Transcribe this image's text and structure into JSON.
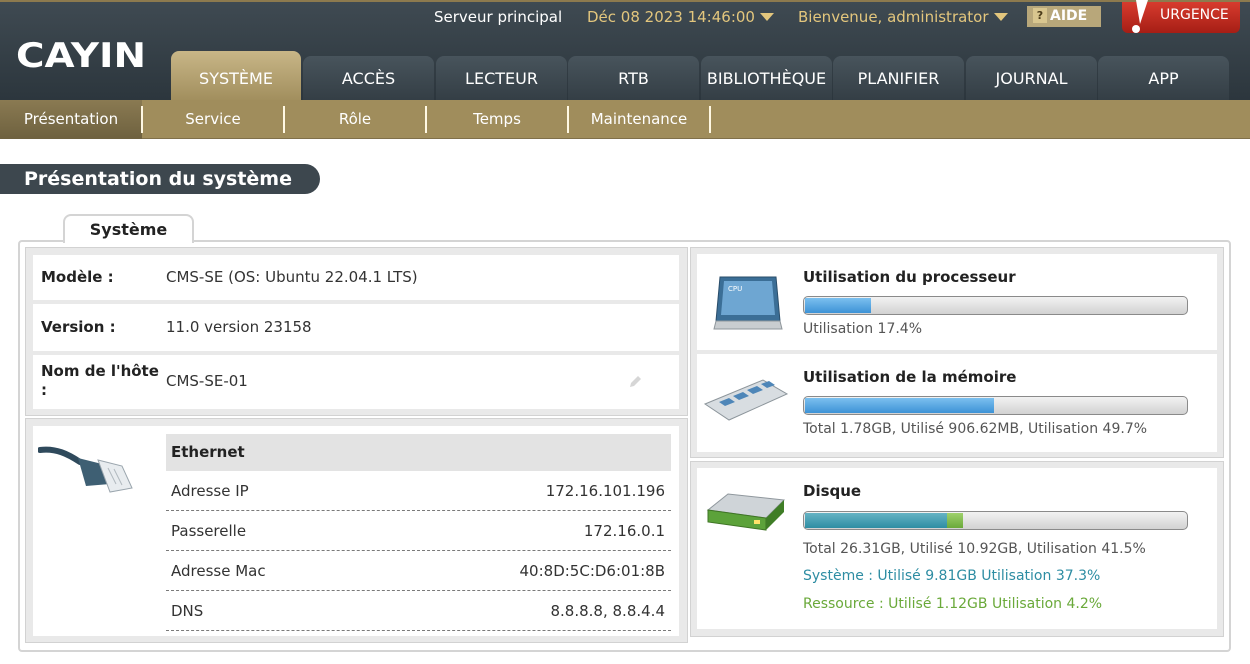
{
  "header": {
    "logo_text": "CAYIN",
    "server": "Serveur principal",
    "datetime": "Déc 08 2023 14:46:00",
    "user": "Bienvenue, administrator",
    "help": "AIDE",
    "help_icon": "?",
    "urgent": "URGENCE"
  },
  "main_tabs": [
    {
      "label": "SYSTÈME",
      "active": true
    },
    {
      "label": "ACCÈS"
    },
    {
      "label": "LECTEUR"
    },
    {
      "label": "RTB"
    },
    {
      "label": "BIBLIOTHÈQUE"
    },
    {
      "label": "PLANIFIER"
    },
    {
      "label": "JOURNAL"
    },
    {
      "label": "APP"
    }
  ],
  "sub_tabs": [
    {
      "label": "Présentation",
      "active": true
    },
    {
      "label": "Service"
    },
    {
      "label": "Rôle"
    },
    {
      "label": "Temps"
    },
    {
      "label": "Maintenance"
    }
  ],
  "page_title": "Présentation du système",
  "section_tab": "Système",
  "info": {
    "model_label": "Modèle :",
    "model_value": "CMS-SE (OS: Ubuntu 22.04.1 LTS)",
    "version_label": "Version :",
    "version_value": "11.0 version 23158",
    "host_label_1": "Nom de l'hôte",
    "host_label_2": ":",
    "host_value": "CMS-SE-01"
  },
  "ethernet": {
    "title": "Ethernet",
    "rows": [
      {
        "label": "Adresse IP",
        "value": "172.16.101.196"
      },
      {
        "label": "Passerelle",
        "value": "172.16.0.1"
      },
      {
        "label": "Adresse Mac",
        "value": "40:8D:5C:D6:01:8B"
      },
      {
        "label": "DNS",
        "value": "8.8.8.8, 8.8.4.4"
      }
    ]
  },
  "cpu": {
    "title": "Utilisation du processeur",
    "text": "Utilisation 17.4%",
    "percent": 17.4,
    "chip_label": "CPU"
  },
  "memory": {
    "title": "Utilisation de la mémoire",
    "text": "Total 1.78GB, Utilisé 906.62MB, Utilisation 49.7%",
    "percent": 49.7
  },
  "disk": {
    "title": "Disque",
    "text": "Total 26.31GB, Utilisé 10.92GB, Utilisation 41.5%",
    "system_text": "Système : Utilisé 9.81GB Utilisation 37.3%",
    "resource_text": "Ressource : Utilisé 1.12GB Utilisation 4.2%",
    "system_percent": 37.3,
    "resource_percent": 4.2
  },
  "colors": {
    "header_bg": "#2c363d",
    "gold_accent": "#a08d5c",
    "date_text": "#e3c67d",
    "urgent_red": "#c0281c",
    "bar_blue": "#3d92d6",
    "system_teal": "#2e8da3",
    "resource_green": "#6aa93a"
  }
}
